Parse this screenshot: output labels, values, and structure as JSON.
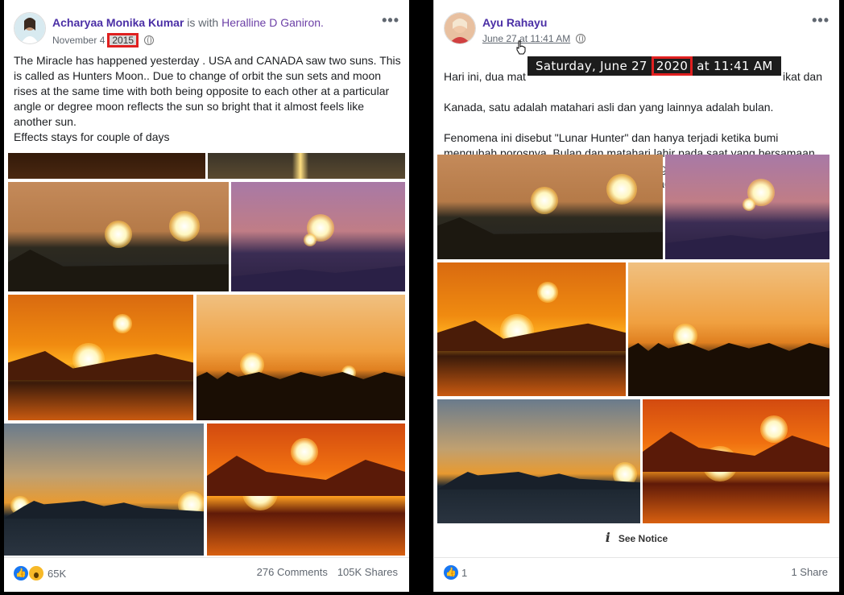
{
  "left_post": {
    "author": "Acharyaa Monika Kumar",
    "with_text": "is with",
    "tagged": "Heralline D Ganiron.",
    "date_prefix": "November 4",
    "date_year": "2015",
    "body": "The Miracle has happened yesterday . USA and CANADA saw two suns. This is called as Hunters Moon.. Due to change of orbit the sun sets and moon rises at the same time with both being opposite to each other at a particular angle or degree moon reflects the sun so bright that it almost feels like another sun.\nEffects stays for couple of days",
    "reactions_count": "65K",
    "comments": "276 Comments",
    "shares": "105K Shares",
    "more_icon": "more-options-icon"
  },
  "right_post": {
    "author": "Ayu Rahayu",
    "date": "June 27 at 11:41 AM",
    "body_line1": "Hari ini, dua mat",
    "body_line1_end": "ikat dan",
    "body_line2": "Kanada, satu adalah matahari asli dan yang lainnya adalah bulan.",
    "body_rest": "Fenomena ini disebut \"Lunar Hunter\" dan hanya terjadi ketika bumi mengubah porosnya. Bulan dan matahari lahir pada saat yang bersamaan, dan bulan memantulkan sinar matahari dengan intensitas yang kuat, mengingatkan kita pada matahari kedua. Bagikan ini! sangat cantik! ! !",
    "tooltip_prefix": "Saturday, June 27",
    "tooltip_year": "2020",
    "tooltip_suffix": "at 11:41 AM",
    "notice": "See Notice",
    "reactions_count": "1",
    "shares": "1 Share"
  },
  "colors": {
    "author": "#4b2fa6",
    "highlight": "#e02020",
    "like": "#1877f2"
  }
}
